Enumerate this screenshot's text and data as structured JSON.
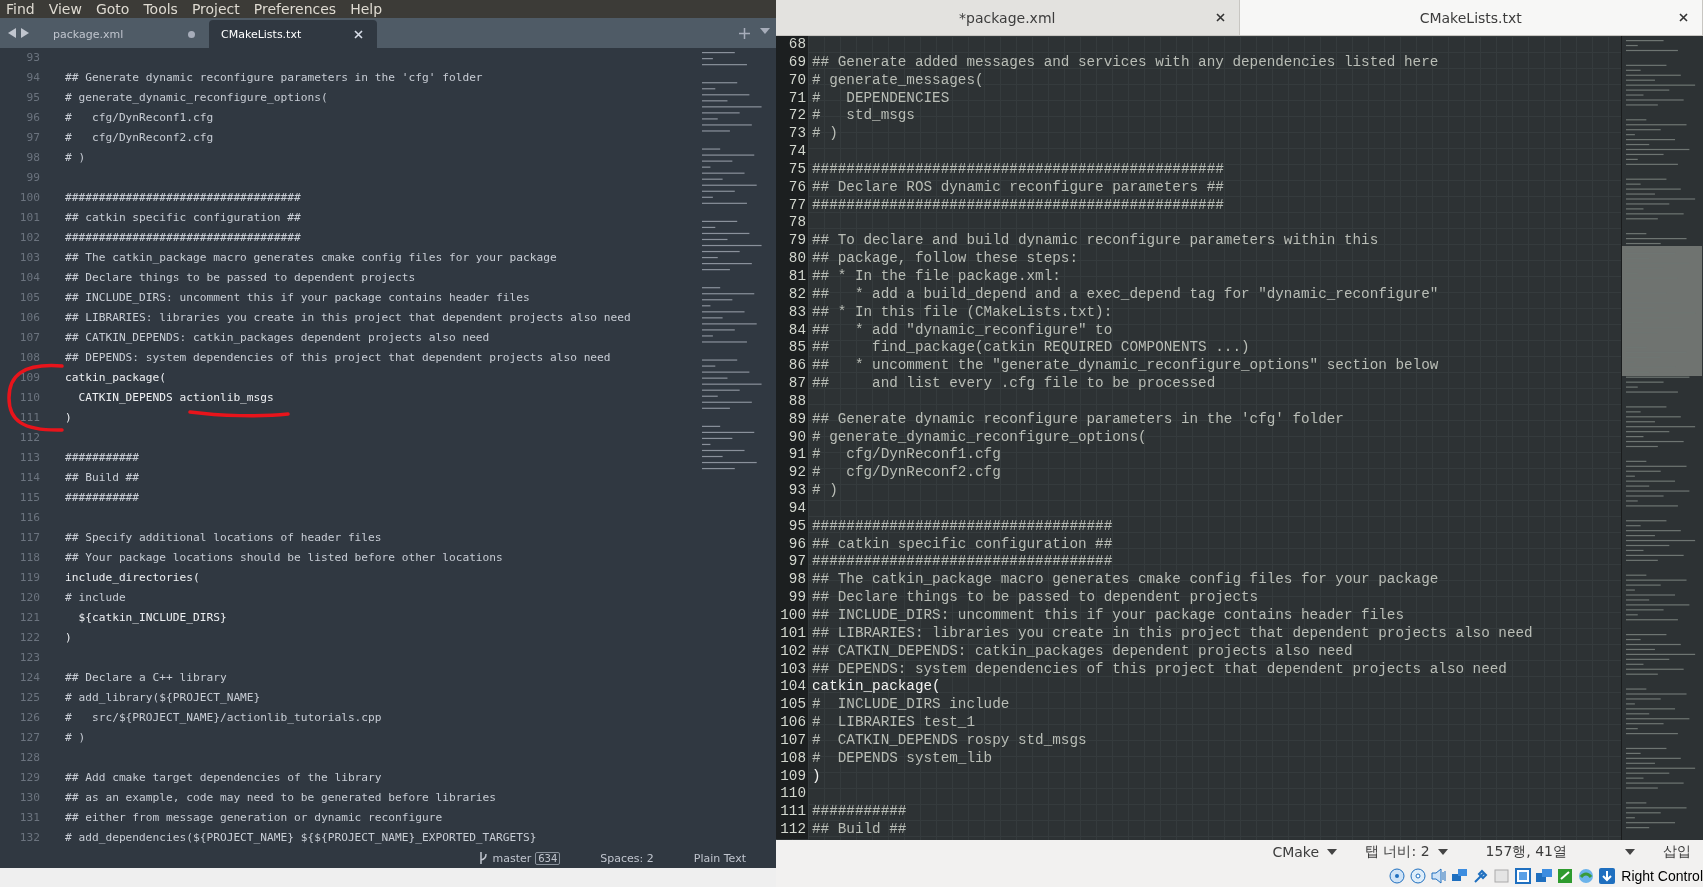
{
  "menu_bar": {
    "items": [
      "Find",
      "View",
      "Goto",
      "Tools",
      "Project",
      "Preferences",
      "Help"
    ]
  },
  "left_editor": {
    "tabs": [
      {
        "label": "package.xml",
        "selected": false,
        "modified": true
      },
      {
        "label": "CMakeLists.txt",
        "selected": true,
        "modified": false
      }
    ],
    "lines": [
      {
        "number": "93"
      },
      {
        "number": "94",
        "kind": "comment",
        "text": "## Generate dynamic reconfigure parameters in the 'cfg' folder"
      },
      {
        "number": "95",
        "kind": "comment",
        "text": "# generate_dynamic_reconfigure_options("
      },
      {
        "number": "96",
        "kind": "comment",
        "text": "#   cfg/DynReconf1.cfg"
      },
      {
        "number": "97",
        "kind": "comment",
        "text": "#   cfg/DynReconf2.cfg"
      },
      {
        "number": "98",
        "kind": "comment",
        "text": "# )"
      },
      {
        "number": "99"
      },
      {
        "number": "100",
        "kind": "comment",
        "text": "###################################"
      },
      {
        "number": "101",
        "kind": "comment",
        "text": "## catkin specific configuration ##"
      },
      {
        "number": "102",
        "kind": "comment",
        "text": "###################################"
      },
      {
        "number": "103",
        "kind": "comment",
        "text": "## The catkin_package macro generates cmake config files for your package"
      },
      {
        "number": "104",
        "kind": "comment",
        "text": "## Declare things to be passed to dependent projects"
      },
      {
        "number": "105",
        "kind": "comment",
        "text": "## INCLUDE_DIRS: uncomment this if your package contains header files"
      },
      {
        "number": "106",
        "kind": "comment",
        "text": "## LIBRARIES: libraries you create in this project that dependent projects also need"
      },
      {
        "number": "107",
        "kind": "comment",
        "text": "## CATKIN_DEPENDS: catkin_packages dependent projects also need"
      },
      {
        "number": "108",
        "kind": "comment",
        "text": "## DEPENDS: system dependencies of this project that dependent projects also need"
      },
      {
        "number": "109",
        "kind": "code",
        "text": "catkin_package("
      },
      {
        "number": "110",
        "kind": "code",
        "text": "  CATKIN_DEPENDS actionlib_msgs"
      },
      {
        "number": "111",
        "kind": "code",
        "text": ")"
      },
      {
        "number": "112"
      },
      {
        "number": "113",
        "kind": "comment",
        "text": "###########"
      },
      {
        "number": "114",
        "kind": "comment",
        "text": "## Build ##"
      },
      {
        "number": "115",
        "kind": "comment",
        "text": "###########"
      },
      {
        "number": "116"
      },
      {
        "number": "117",
        "kind": "comment",
        "text": "## Specify additional locations of header files"
      },
      {
        "number": "118",
        "kind": "comment",
        "text": "## Your package locations should be listed before other locations"
      },
      {
        "number": "119",
        "kind": "code",
        "text": "include_directories("
      },
      {
        "number": "120",
        "kind": "comment",
        "text": "# include"
      },
      {
        "number": "121",
        "kind": "code",
        "text": "  ${catkin_INCLUDE_DIRS}"
      },
      {
        "number": "122",
        "kind": "code",
        "text": ")"
      },
      {
        "number": "123"
      },
      {
        "number": "124",
        "kind": "comment",
        "text": "## Declare a C++ library"
      },
      {
        "number": "125",
        "kind": "comment",
        "text": "# add_library(${PROJECT_NAME}"
      },
      {
        "number": "126",
        "kind": "comment",
        "text": "#   src/${PROJECT_NAME}/actionlib_tutorials.cpp"
      },
      {
        "number": "127",
        "kind": "comment",
        "text": "# )"
      },
      {
        "number": "128"
      },
      {
        "number": "129",
        "kind": "comment",
        "text": "## Add cmake target dependencies of the library"
      },
      {
        "number": "130",
        "kind": "comment",
        "text": "## as an example, code may need to be generated before libraries"
      },
      {
        "number": "131",
        "kind": "comment",
        "text": "## either from message generation or dynamic reconfigure"
      },
      {
        "number": "132",
        "kind": "comment",
        "text": "# add_dependencies(${PROJECT_NAME} ${${PROJECT_NAME}_EXPORTED_TARGETS}"
      }
    ],
    "status_bar": {
      "branch": "master",
      "badge": "634",
      "indentation": "Spaces: 2",
      "syntax": "Plain Text"
    }
  },
  "right_editor": {
    "tabs": [
      {
        "label": "*package.xml",
        "selected": false
      },
      {
        "label": "CMakeLists.txt",
        "selected": true
      }
    ],
    "lines": [
      {
        "number": "68"
      },
      {
        "number": "69",
        "kind": "comment",
        "text": "## Generate added messages and services with any dependencies listed here"
      },
      {
        "number": "70",
        "kind": "comment",
        "text": "# generate_messages("
      },
      {
        "number": "71",
        "kind": "comment",
        "text": "#   DEPENDENCIES"
      },
      {
        "number": "72",
        "kind": "comment",
        "text": "#   std_msgs"
      },
      {
        "number": "73",
        "kind": "comment",
        "text": "# )"
      },
      {
        "number": "74"
      },
      {
        "number": "75",
        "kind": "comment",
        "text": "################################################"
      },
      {
        "number": "76",
        "kind": "comment",
        "text": "## Declare ROS dynamic reconfigure parameters ##"
      },
      {
        "number": "77",
        "kind": "comment",
        "text": "################################################"
      },
      {
        "number": "78"
      },
      {
        "number": "79",
        "kind": "comment",
        "text": "## To declare and build dynamic reconfigure parameters within this"
      },
      {
        "number": "80",
        "kind": "comment",
        "text": "## package, follow these steps:"
      },
      {
        "number": "81",
        "kind": "comment",
        "text": "## * In the file package.xml:"
      },
      {
        "number": "82",
        "kind": "comment",
        "text": "##   * add a build_depend and a exec_depend tag for \"dynamic_reconfigure\""
      },
      {
        "number": "83",
        "kind": "comment",
        "text": "## * In this file (CMakeLists.txt):"
      },
      {
        "number": "84",
        "kind": "comment",
        "text": "##   * add \"dynamic_reconfigure\" to"
      },
      {
        "number": "85",
        "kind": "comment",
        "text": "##     find_package(catkin REQUIRED COMPONENTS ...)"
      },
      {
        "number": "86",
        "kind": "comment",
        "text": "##   * uncomment the \"generate_dynamic_reconfigure_options\" section below"
      },
      {
        "number": "87",
        "kind": "comment",
        "text": "##     and list every .cfg file to be processed"
      },
      {
        "number": "88"
      },
      {
        "number": "89",
        "kind": "comment",
        "text": "## Generate dynamic reconfigure parameters in the 'cfg' folder"
      },
      {
        "number": "90",
        "kind": "comment",
        "text": "# generate_dynamic_reconfigure_options("
      },
      {
        "number": "91",
        "kind": "comment",
        "text": "#   cfg/DynReconf1.cfg"
      },
      {
        "number": "92",
        "kind": "comment",
        "text": "#   cfg/DynReconf2.cfg"
      },
      {
        "number": "93",
        "kind": "comment",
        "text": "# )"
      },
      {
        "number": "94"
      },
      {
        "number": "95",
        "kind": "comment",
        "text": "###################################"
      },
      {
        "number": "96",
        "kind": "comment",
        "text": "## catkin specific configuration ##"
      },
      {
        "number": "97",
        "kind": "comment",
        "text": "###################################"
      },
      {
        "number": "98",
        "kind": "comment",
        "text": "## The catkin_package macro generates cmake config files for your package"
      },
      {
        "number": "99",
        "kind": "comment",
        "text": "## Declare things to be passed to dependent projects"
      },
      {
        "number": "100",
        "kind": "comment",
        "text": "## INCLUDE_DIRS: uncomment this if your package contains header files"
      },
      {
        "number": "101",
        "kind": "comment",
        "text": "## LIBRARIES: libraries you create in this project that dependent projects also need"
      },
      {
        "number": "102",
        "kind": "comment",
        "text": "## CATKIN_DEPENDS: catkin_packages dependent projects also need"
      },
      {
        "number": "103",
        "kind": "comment",
        "text": "## DEPENDS: system dependencies of this project that dependent projects also need"
      },
      {
        "number": "104",
        "kind": "code",
        "text": "catkin_package("
      },
      {
        "number": "105",
        "kind": "comment",
        "text": "#  INCLUDE_DIRS include"
      },
      {
        "number": "106",
        "kind": "comment",
        "text": "#  LIBRARIES test_1"
      },
      {
        "number": "107",
        "kind": "comment",
        "text": "#  CATKIN_DEPENDS rospy std_msgs"
      },
      {
        "number": "108",
        "kind": "comment",
        "text": "#  DEPENDS system_lib"
      },
      {
        "number": "109",
        "kind": "code",
        "text": ")"
      },
      {
        "number": "110"
      },
      {
        "number": "111",
        "kind": "comment",
        "text": "###########"
      },
      {
        "number": "112",
        "kind": "comment",
        "text": "## Build ##"
      }
    ],
    "status_bar": {
      "language": "CMake",
      "tab_width": "탭 너비: 2",
      "position": "157행, 41열",
      "mode": "삽입"
    }
  },
  "host_tray": {
    "key_label": "Right Control"
  }
}
